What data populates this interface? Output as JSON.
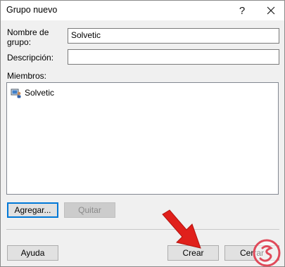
{
  "window": {
    "title": "Grupo nuevo",
    "help_label": "?",
    "close_icon": "close-icon"
  },
  "form": {
    "name_label_line1": "Nombre de",
    "name_label_line2": "grupo:",
    "name_value": "Solvetic",
    "description_label": "Descripción:",
    "description_value": "",
    "members_label": "Miembros:"
  },
  "members": {
    "items": [
      {
        "label": "Solvetic",
        "icon": "user-group-icon"
      }
    ]
  },
  "buttons": {
    "add": "Agregar...",
    "remove": "Quitar",
    "help": "Ayuda",
    "create": "Crear",
    "close": "Cerrar"
  },
  "colors": {
    "focus": "#0078d7",
    "arrow": "#e0201b",
    "logo": "#e04a5a"
  }
}
